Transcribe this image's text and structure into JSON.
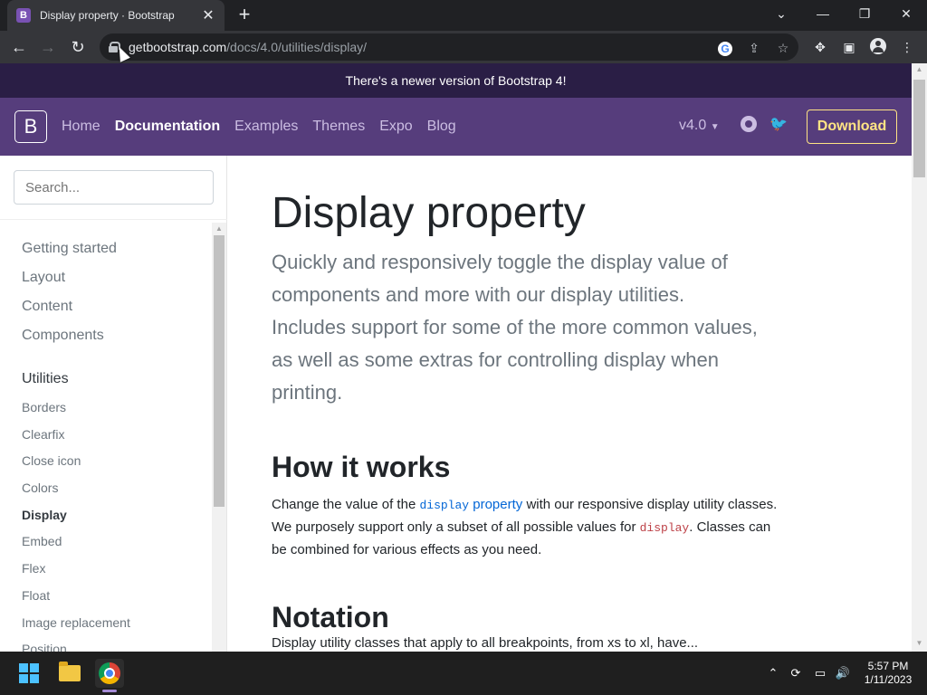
{
  "browser": {
    "tab_title": "Display property · Bootstrap",
    "tab_favicon_letter": "B",
    "url_host": "getbootstrap.com",
    "url_path": "/docs/4.0/utilities/display/"
  },
  "banner": {
    "text": "There's a newer version of Bootstrap 4!"
  },
  "navbar": {
    "logo": "B",
    "links": [
      "Home",
      "Documentation",
      "Examples",
      "Themes",
      "Expo",
      "Blog"
    ],
    "active_link": "Documentation",
    "version": "v4.0",
    "download_label": "Download"
  },
  "sidebar": {
    "search_placeholder": "Search...",
    "sections": [
      "Getting started",
      "Layout",
      "Content",
      "Components"
    ],
    "active_section": "Utilities",
    "sub_items": [
      "Borders",
      "Clearfix",
      "Close icon",
      "Colors",
      "Display",
      "Embed",
      "Flex",
      "Float",
      "Image replacement",
      "Position"
    ],
    "current_item": "Display"
  },
  "content": {
    "title": "Display property",
    "lead": "Quickly and responsively toggle the display value of components and more with our display utilities. Includes support for some of the more common values, as well as some extras for controlling display when printing.",
    "h2_how": "How it works",
    "para_1": "Change the value of the ",
    "para_link_code": "display",
    "para_link_text": " property",
    "para_2": " with our responsive display utility classes. We purposely support only a subset of all possible values for ",
    "para_code": "display",
    "para_3": ". Classes can be combined for various effects as you need.",
    "h2_notation": "Notation",
    "peek": "Display utility classes that apply to all breakpoints, from xs to xl, have..."
  },
  "taskbar": {
    "time": "5:57 PM",
    "date": "1/11/2023"
  },
  "colors": {
    "bootstrap_purple": "#563d7c",
    "banner_bg": "#2a1e45",
    "download_yellow": "#ffe484",
    "link_blue": "#0366d6",
    "code_red": "#bd4147"
  }
}
